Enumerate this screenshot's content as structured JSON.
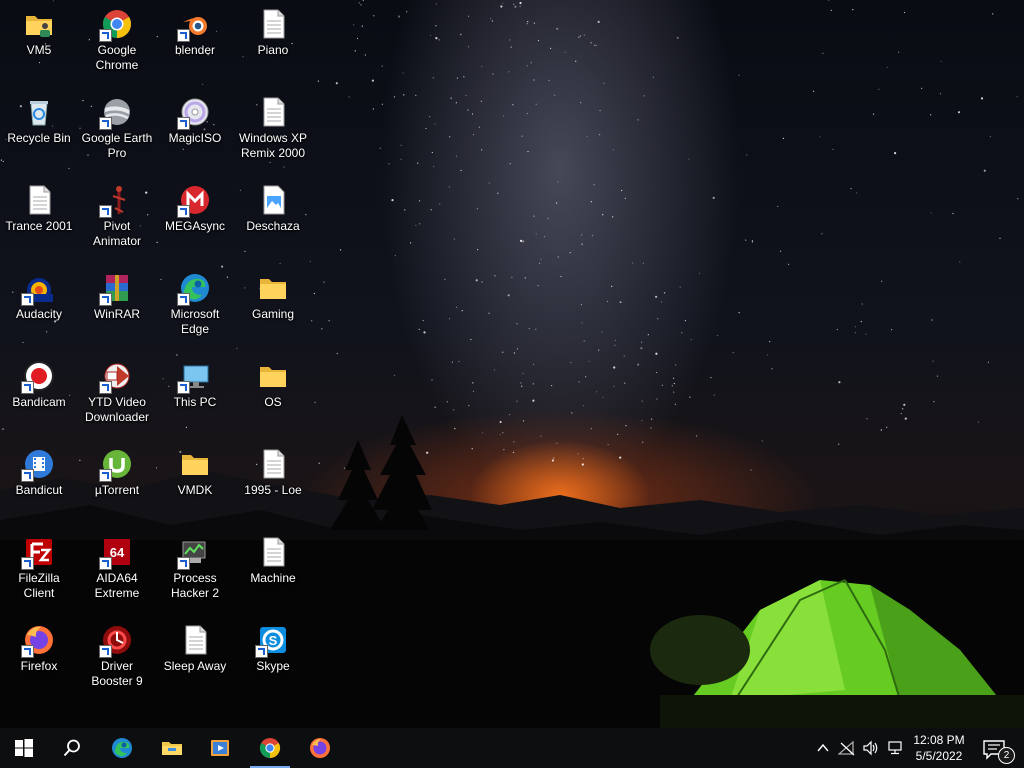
{
  "desktop_icons": [
    {
      "label": "VM5",
      "icon": "folder-user-icon"
    },
    {
      "label": "Google Chrome",
      "icon": "chrome-icon"
    },
    {
      "label": "blender",
      "icon": "blender-icon"
    },
    {
      "label": "Piano",
      "icon": "document-icon"
    },
    {
      "label": "Recycle Bin",
      "icon": "recycle-bin-icon"
    },
    {
      "label": "Google Earth Pro",
      "icon": "google-earth-icon"
    },
    {
      "label": "MagicISO",
      "icon": "disc-icon"
    },
    {
      "label": "Windows XP Remix 2000",
      "icon": "document-icon"
    },
    {
      "label": "Trance 2001",
      "icon": "document-icon"
    },
    {
      "label": "Pivot Animator",
      "icon": "pivot-icon"
    },
    {
      "label": "MEGAsync",
      "icon": "mega-icon"
    },
    {
      "label": "Deschaza",
      "icon": "image-file-icon"
    },
    {
      "label": "Audacity",
      "icon": "audacity-icon"
    },
    {
      "label": "WinRAR",
      "icon": "winrar-icon"
    },
    {
      "label": "Microsoft Edge",
      "icon": "edge-icon"
    },
    {
      "label": "Gaming",
      "icon": "folder-icon"
    },
    {
      "label": "Bandicam",
      "icon": "bandicam-icon"
    },
    {
      "label": "YTD Video Downloader",
      "icon": "ytd-icon"
    },
    {
      "label": "This PC",
      "icon": "this-pc-icon"
    },
    {
      "label": "OS",
      "icon": "folder-icon"
    },
    {
      "label": "Bandicut",
      "icon": "bandicut-icon"
    },
    {
      "label": "µTorrent",
      "icon": "utorrent-icon"
    },
    {
      "label": "VMDK",
      "icon": "folder-icon"
    },
    {
      "label": "1995 - Loe",
      "icon": "document-icon"
    },
    {
      "label": "FileZilla Client",
      "icon": "filezilla-icon"
    },
    {
      "label": "AIDA64 Extreme",
      "icon": "aida64-icon"
    },
    {
      "label": "Process Hacker 2",
      "icon": "process-hacker-icon"
    },
    {
      "label": "Machine",
      "icon": "document-icon"
    },
    {
      "label": "Firefox",
      "icon": "firefox-icon"
    },
    {
      "label": "Driver Booster 9",
      "icon": "driver-booster-icon"
    },
    {
      "label": "Sleep Away",
      "icon": "document-icon"
    },
    {
      "label": "Skype",
      "icon": "skype-icon"
    }
  ],
  "taskbar": {
    "start": "windows-logo-icon",
    "search": "search-icon",
    "pinned": [
      "edge-icon",
      "file-explorer-icon",
      "media-player-icon",
      "chrome-icon",
      "firefox-icon"
    ],
    "active_app": "chrome-icon"
  },
  "tray": {
    "icons": [
      "chevron-up-icon",
      "network-icon",
      "volume-icon",
      "display-icon"
    ],
    "time": "12:08 PM",
    "date": "5/5/2022",
    "notification_count": "2"
  }
}
